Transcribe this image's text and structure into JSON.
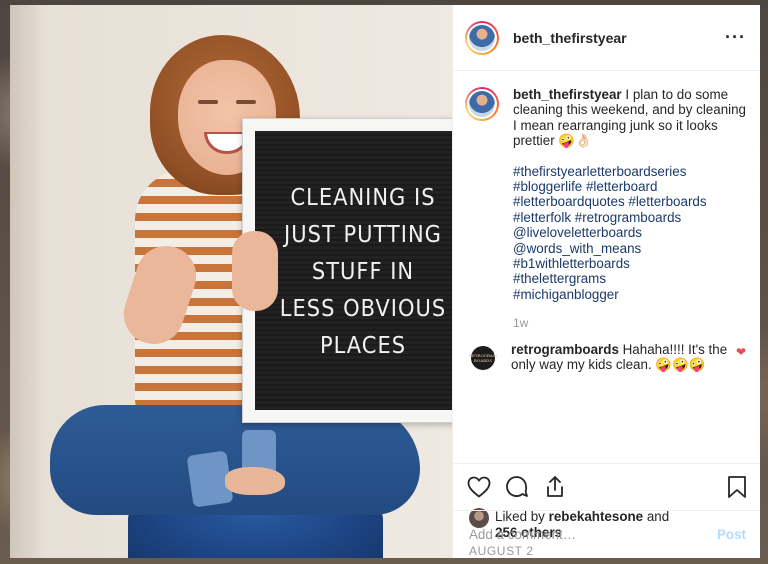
{
  "post": {
    "username": "beth_thefirstyear",
    "photo_text": [
      "CLEANING IS",
      "JUST PUTTING",
      "STUFF IN",
      "LESS OBVIOUS",
      "PLACES"
    ]
  },
  "header": {
    "username": "beth_thefirstyear",
    "more_label": "···"
  },
  "caption": {
    "username": "beth_thefirstyear",
    "text": " I plan to do some cleaning this weekend, and by cleaning I mean rearranging junk so it looks prettier 🤪👌🏻",
    "hashtags": [
      "#thefirstyearletterboardseries",
      "#bloggerlife #letterboard",
      "#letterboardquotes #letterboards",
      "#letterfolk #retrogramboards",
      "@liveloveletterboards",
      "@words_with_means",
      "#b1withletterboards",
      "#thelettergrams",
      "#michiganblogger"
    ],
    "age": "1w"
  },
  "comments": [
    {
      "username": "retrogramboards",
      "text": " Hahaha!!!! It's the only way my kids clean. 🤪🤪🤪",
      "avatar_text": "RETROGRAM BOARDS"
    }
  ],
  "likes": {
    "prefix": "Liked by ",
    "user": "rebekahtesone",
    "middle": " and",
    "count": "256 others"
  },
  "date": "AUGUST 2",
  "comment_box": {
    "placeholder": "Add a comment…",
    "post_label": "Post"
  },
  "colors": {
    "link": "#1b3a6b",
    "heart": "#ed4956",
    "post_disabled": "#b3dbff"
  },
  "icons": [
    "heart-icon",
    "comment-icon",
    "share-icon",
    "bookmark-icon",
    "more-options-icon"
  ]
}
